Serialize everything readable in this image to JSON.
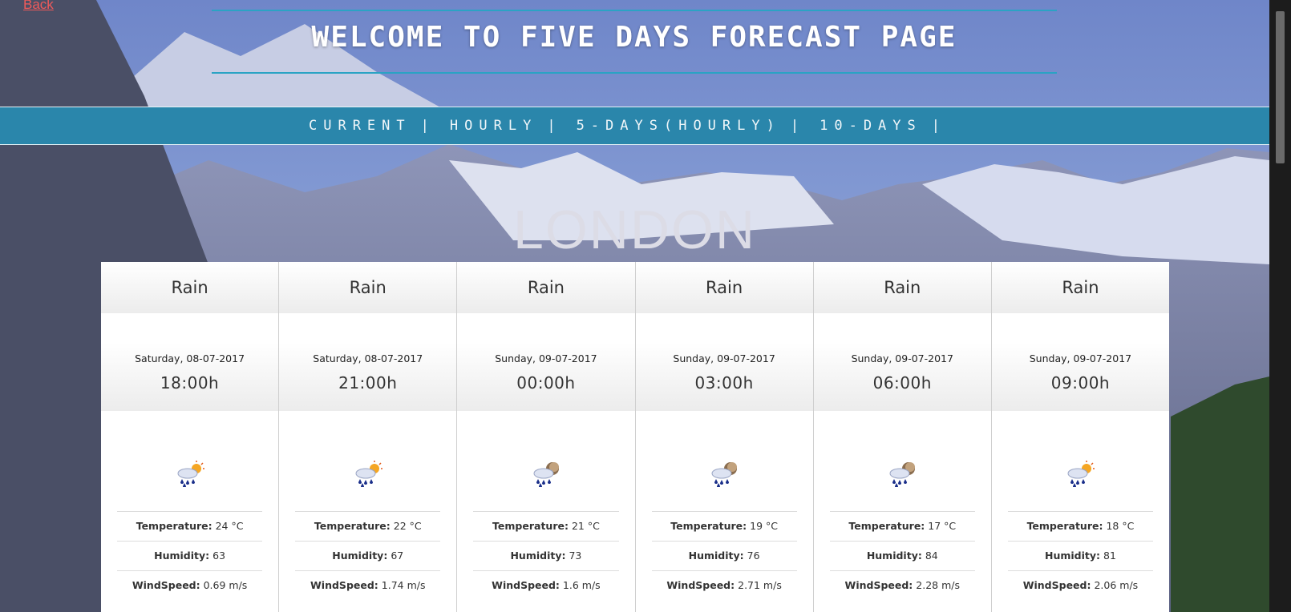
{
  "header": {
    "back_link": "Back",
    "title": "WELCOME TO FIVE DAYS FORECAST PAGE"
  },
  "nav": {
    "items": [
      {
        "label": "CURRENT"
      },
      {
        "label": "HOURLY"
      },
      {
        "label": "5-DAYS(HOURLY)"
      },
      {
        "label": "10-DAYS"
      }
    ],
    "separator": "|"
  },
  "city": "LONDON",
  "labels": {
    "temperature": "Temperature:",
    "humidity": "Humidity:",
    "windspeed": "WindSpeed:"
  },
  "forecast": [
    {
      "condition": "Rain",
      "date": "Saturday, 08-07-2017",
      "time": "18:00h",
      "icon": "rain-sun-icon",
      "temperature": "24 °C",
      "humidity": "63",
      "windspeed": "0.69 m/s"
    },
    {
      "condition": "Rain",
      "date": "Saturday, 08-07-2017",
      "time": "21:00h",
      "icon": "rain-sun-icon",
      "temperature": "22 °C",
      "humidity": "67",
      "windspeed": "1.74 m/s"
    },
    {
      "condition": "Rain",
      "date": "Sunday, 09-07-2017",
      "time": "00:00h",
      "icon": "rain-moon-icon",
      "temperature": "21 °C",
      "humidity": "73",
      "windspeed": "1.6 m/s"
    },
    {
      "condition": "Rain",
      "date": "Sunday, 09-07-2017",
      "time": "03:00h",
      "icon": "rain-moon-icon",
      "temperature": "19 °C",
      "humidity": "76",
      "windspeed": "2.71 m/s"
    },
    {
      "condition": "Rain",
      "date": "Sunday, 09-07-2017",
      "time": "06:00h",
      "icon": "rain-moon-icon",
      "temperature": "17 °C",
      "humidity": "84",
      "windspeed": "2.28 m/s"
    },
    {
      "condition": "Rain",
      "date": "Sunday, 09-07-2017",
      "time": "09:00h",
      "icon": "rain-sun-icon",
      "temperature": "18 °C",
      "humidity": "81",
      "windspeed": "2.06 m/s"
    }
  ]
}
